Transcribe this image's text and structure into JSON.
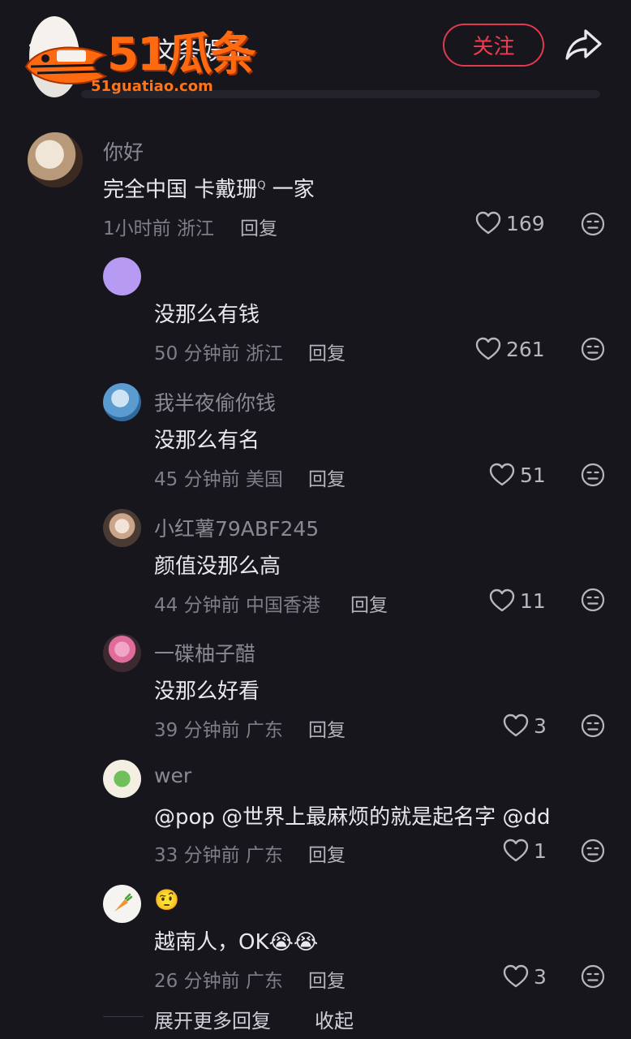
{
  "header": {
    "title": "文条娱乐",
    "follow_label": "关注",
    "watermark_brand": "51瓜条",
    "watermark_url": "51guatiao.com"
  },
  "comments": [
    {
      "name": "你好",
      "text": "完全中国 卡戴珊",
      "search_glyph": "Q",
      "text_suffix": " 一家",
      "time": "1小时前",
      "location": "浙江",
      "reply_label": "回复",
      "likes": "169"
    },
    {
      "name": "",
      "text": "没那么有钱",
      "time": "50 分钟前",
      "location": "浙江",
      "reply_label": "回复",
      "likes": "261"
    },
    {
      "name": "我半夜偷你钱",
      "text": "没那么有名",
      "time": "45 分钟前",
      "location": "美国",
      "reply_label": "回复",
      "likes": "51"
    },
    {
      "name": "小红薯79ABF245",
      "text": "颜值没那么高",
      "time": "44 分钟前",
      "location": "中国香港",
      "reply_label": "回复",
      "likes": "11"
    },
    {
      "name": "一碟柚子醋",
      "text": "没那么好看",
      "time": "39 分钟前",
      "location": "广东",
      "reply_label": "回复",
      "likes": "3"
    },
    {
      "name": "wer",
      "text": "@pop @世界上最麻烦的就是起名字 @dd",
      "time": "33 分钟前",
      "location": "广东",
      "reply_label": "回复",
      "likes": "1"
    },
    {
      "name": "🤨",
      "text": "越南人，OK😭😭",
      "time": "26 分钟前",
      "location": "广东",
      "reply_label": "回复",
      "likes": "3"
    }
  ],
  "footer": {
    "expand_label": "展开更多回复",
    "collapse_label": "收起"
  },
  "colors": {
    "background": "#17161d",
    "accent_red": "#ee3b50",
    "watermark_orange": "#ff6a10"
  }
}
